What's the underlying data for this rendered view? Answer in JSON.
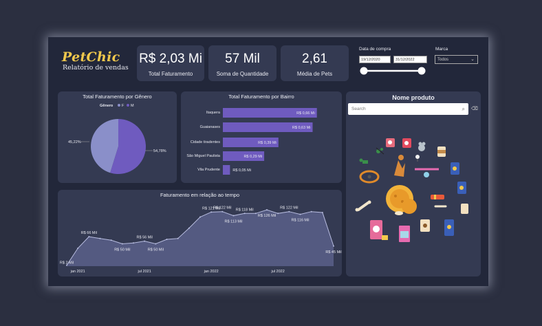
{
  "logo": {
    "name": "PetChic",
    "subtitle": "Relatório de vendas"
  },
  "kpis": [
    {
      "value": "R$ 2,03 Mi",
      "label": "Total Faturamento"
    },
    {
      "value": "57 Mil",
      "label": "Soma de Quantidade"
    },
    {
      "value": "2,61",
      "label": "Média de Pets"
    }
  ],
  "filters": {
    "date_label": "Data de compra",
    "date_start": "19/12/2020",
    "date_end": "31/12/2022",
    "brand_label": "Marca",
    "brand_value": "Todos"
  },
  "gender_chart": {
    "title": "Total Faturamento por Gênero",
    "legend_title": "Gênero",
    "legend": [
      "F",
      "M"
    ],
    "label_f": "45,22%",
    "label_m": "54,78%"
  },
  "bairro_chart": {
    "title": "Total Faturamento por Bairro"
  },
  "time_chart": {
    "title": "Faturamento em relação ao tempo",
    "x_ticks": [
      "jan 2021",
      "jul 2021",
      "jan 2022",
      "jul 2022"
    ]
  },
  "product_panel": {
    "title": "Nome produto",
    "search_placeholder": "Search"
  },
  "colors": {
    "accent": "#6f5bbf",
    "female": "#8a8fc9",
    "male": "#6f5bbf",
    "card": "#343a52",
    "background": "#22273a"
  },
  "chart_data": [
    {
      "type": "pie",
      "title": "Total Faturamento por Gênero",
      "labels": [
        "F",
        "M"
      ],
      "values": [
        45.22,
        54.78
      ],
      "unit": "%"
    },
    {
      "type": "bar",
      "title": "Total Faturamento por Bairro",
      "orientation": "horizontal",
      "categories": [
        "Itaquera",
        "Guaianases",
        "Cidade tiradentes",
        "São Miguel Paulista",
        "Vila Prudente"
      ],
      "values": [
        0.66,
        0.63,
        0.39,
        0.29,
        0.05
      ],
      "value_labels": [
        "R$ 0,66 Mi",
        "R$ 0,63 Mi",
        "R$ 0,39 Mi",
        "R$ 0,29 Mi",
        "R$ 0,05 Mi"
      ],
      "unit": "R$ Mi"
    },
    {
      "type": "area",
      "title": "Faturamento em relação ao tempo",
      "x_ticks": [
        "jan 2021",
        "jul 2021",
        "jan 2022",
        "jul 2022"
      ],
      "x": [
        "2020-12",
        "2021-01",
        "2021-02",
        "2021-03",
        "2021-04",
        "2021-05",
        "2021-06",
        "2021-07",
        "2021-08",
        "2021-09",
        "2021-10",
        "2021-11",
        "2021-12",
        "2022-01",
        "2022-02",
        "2022-03",
        "2022-04",
        "2022-05",
        "2022-06",
        "2022-07",
        "2022-08",
        "2022-09",
        "2022-10",
        "2022-11",
        "2022-12"
      ],
      "values": [
        2,
        40,
        66,
        62,
        58,
        50,
        52,
        56,
        50,
        60,
        62,
        85,
        110,
        121,
        122,
        113,
        118,
        118,
        126,
        118,
        122,
        116,
        122,
        120,
        45
      ],
      "data_labels": [
        {
          "index": 0,
          "text": "R$ 2 Mil"
        },
        {
          "index": 2,
          "text": "R$ 66 Mil"
        },
        {
          "index": 5,
          "text": "R$ 50 Mil"
        },
        {
          "index": 7,
          "text": "R$ 56 Mil"
        },
        {
          "index": 8,
          "text": "R$ 50 Mil"
        },
        {
          "index": 13,
          "text": "R$ 121 Mil"
        },
        {
          "index": 14,
          "text": "R$ 122 Mil"
        },
        {
          "index": 15,
          "text": "R$ 113 Mil"
        },
        {
          "index": 16,
          "text": "R$ 118 Mil"
        },
        {
          "index": 18,
          "text": "R$ 126 Mil"
        },
        {
          "index": 20,
          "text": "R$ 122 Mil"
        },
        {
          "index": 21,
          "text": "R$ 116 Mil"
        },
        {
          "index": 24,
          "text": "R$ 45 Mil"
        }
      ],
      "unit": "R$ Mil"
    }
  ]
}
